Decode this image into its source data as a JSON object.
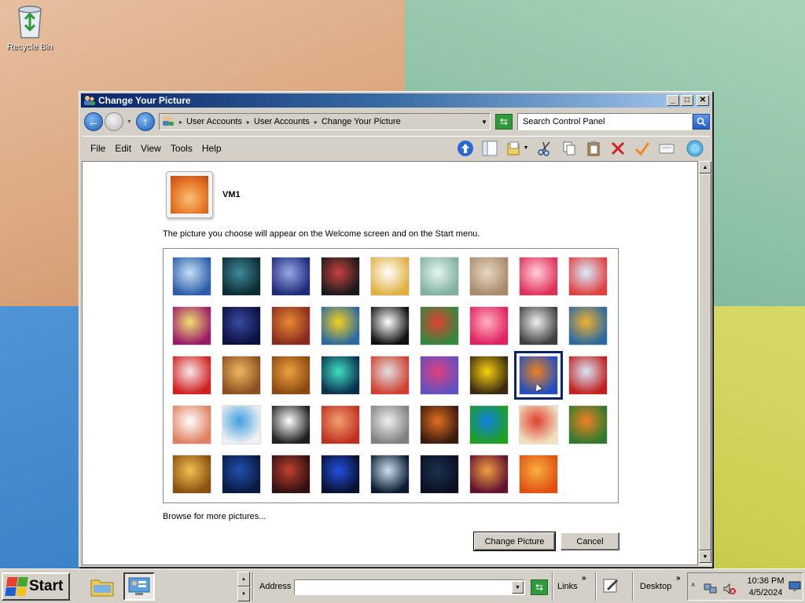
{
  "desktop": {
    "icons": [
      {
        "label": "Recycle Bin",
        "icon": "recycle-bin-icon"
      }
    ]
  },
  "window": {
    "title": "Change Your Picture",
    "controls": {
      "minimize": "_",
      "maximize": "□",
      "close": "✕"
    }
  },
  "nav": {
    "breadcrumbs": [
      "User Accounts",
      "User Accounts",
      "Change Your Picture"
    ],
    "search_placeholder": "Search Control Panel"
  },
  "menu": {
    "items": [
      "File",
      "Edit",
      "View",
      "Tools",
      "Help"
    ]
  },
  "account": {
    "user_name": "VM1"
  },
  "main": {
    "info_text": "The picture you choose will appear on the Welcome screen and on the Start menu.",
    "browse_link": "Browse for more pictures...",
    "change_button": "Change Picture",
    "cancel_button": "Cancel",
    "selected_index": 25,
    "pictures": [
      {
        "name": "frosted-trees",
        "c1": "#c7dff7",
        "c2": "#2b5da8"
      },
      {
        "name": "forest-light",
        "c1": "#3d8a9a",
        "c2": "#0c2b33"
      },
      {
        "name": "night-sky",
        "c1": "#9aa8e8",
        "c2": "#1d2a7a"
      },
      {
        "name": "record-player",
        "c1": "#c94040",
        "c2": "#1a1a1a"
      },
      {
        "name": "lucky-cat",
        "c1": "#ffffff",
        "c2": "#e0b040"
      },
      {
        "name": "gyroscope",
        "c1": "#e6f5f0",
        "c2": "#7fb0a0"
      },
      {
        "name": "sleeping-kitten",
        "c1": "#e8d8c4",
        "c2": "#a88a6a"
      },
      {
        "name": "pink-flower",
        "c1": "#ffd0da",
        "c2": "#e0305a"
      },
      {
        "name": "pinwheel",
        "c1": "#d8ecff",
        "c2": "#e04040"
      },
      {
        "name": "beach-ball",
        "c1": "#f0e070",
        "c2": "#9a1a6a"
      },
      {
        "name": "starfield",
        "c1": "#3a4aa0",
        "c2": "#0a1040"
      },
      {
        "name": "woven-fabric",
        "c1": "#e88a30",
        "c2": "#8a2a20"
      },
      {
        "name": "yellow-leaf",
        "c1": "#f2d020",
        "c2": "#2a6aa0"
      },
      {
        "name": "border-collie",
        "c1": "#ffffff",
        "c2": "#101010"
      },
      {
        "name": "crayons",
        "c1": "#e04030",
        "c2": "#308a40"
      },
      {
        "name": "paper-star",
        "c1": "#ffb0c0",
        "c2": "#e02060"
      },
      {
        "name": "jacks",
        "c1": "#f0f0f0",
        "c2": "#404040"
      },
      {
        "name": "staircase",
        "c1": "#f0b030",
        "c2": "#2a6aa0"
      },
      {
        "name": "origami-crane",
        "c1": "#f8e8e8",
        "c2": "#d02020"
      },
      {
        "name": "guitar",
        "c1": "#f0b860",
        "c2": "#8a5020"
      },
      {
        "name": "pomeranian",
        "c1": "#f0a040",
        "c2": "#8a4a10"
      },
      {
        "name": "aurora",
        "c1": "#40e0c0",
        "c2": "#0a3050"
      },
      {
        "name": "toy-robot",
        "c1": "#e0e0e0",
        "c2": "#d04030"
      },
      {
        "name": "silk-fabric",
        "c1": "#e04080",
        "c2": "#6050c0"
      },
      {
        "name": "sunflower",
        "c1": "#f8d010",
        "c2": "#3a2a10"
      },
      {
        "name": "orange-fish",
        "c1": "#f08020",
        "c2": "#2050c0"
      },
      {
        "name": "hot-air-balloon",
        "c1": "#d8e8f8",
        "c2": "#c02020"
      },
      {
        "name": "daruma-doll",
        "c1": "#ffffff",
        "c2": "#e08060"
      },
      {
        "name": "sailboat",
        "c1": "#40a0e0",
        "c2": "#f0f0f0"
      },
      {
        "name": "soccer-ball",
        "c1": "#ffffff",
        "c2": "#202020"
      },
      {
        "name": "striped-pattern",
        "c1": "#f0a070",
        "c2": "#c03020"
      },
      {
        "name": "marbles",
        "c1": "#f0f0f0",
        "c2": "#808080"
      },
      {
        "name": "street-lamp",
        "c1": "#e07020",
        "c2": "#3a1a10"
      },
      {
        "name": "green-window",
        "c1": "#1080e0",
        "c2": "#20a020"
      },
      {
        "name": "textile-pattern",
        "c1": "#e04030",
        "c2": "#f0e0c0"
      },
      {
        "name": "monarch-butterfly",
        "c1": "#f08020",
        "c2": "#307a30"
      },
      {
        "name": "wicker-spiral",
        "c1": "#f0c050",
        "c2": "#8a5010"
      },
      {
        "name": "lighthouse",
        "c1": "#2050b0",
        "c2": "#0a1a40"
      },
      {
        "name": "night-building",
        "c1": "#c04030",
        "c2": "#301010"
      },
      {
        "name": "solar-panels",
        "c1": "#2050e0",
        "c2": "#0a1030"
      },
      {
        "name": "full-moon",
        "c1": "#d0e0f0",
        "c2": "#0a1a30"
      },
      {
        "name": "dark-sky",
        "c1": "#1a3050",
        "c2": "#0a1020"
      },
      {
        "name": "sunset-tree",
        "c1": "#f0a040",
        "c2": "#601030"
      },
      {
        "name": "orange-daisy",
        "c1": "#f8b040",
        "c2": "#e05010"
      }
    ]
  },
  "taskbar": {
    "start_label": "Start",
    "address_label": "Address",
    "links_label": "Links",
    "desktop_label": "Desktop",
    "time": "10:36 PM",
    "date": "4/5/2024"
  }
}
